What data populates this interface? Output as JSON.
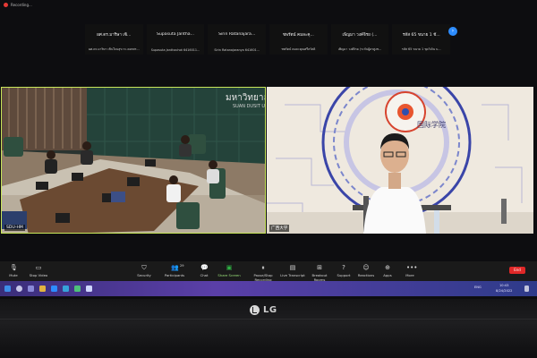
{
  "window": {
    "recording_label": "Recording..."
  },
  "participants_strip": [
    {
      "name": "ผศ.ดร.มาริษา เซ็...",
      "sub": "ผศ.ดร.มาริษา เซ็นใจนสุข ระ.คยรศร..."
    },
    {
      "name": "Supasuta Jantha...",
      "sub": "Supasuta Janthachot 6416011..."
    },
    {
      "name": "Sirin Ratanajara...",
      "sub": "Sirin Ratanajaranya 641601..."
    },
    {
      "name": "ชพรัตน์ คมละคุ...",
      "sub": "ชพรัตน์ คมละคุณศรีสวัสดิ์"
    },
    {
      "name": "เพ็ญมา วงค์จิรย (...",
      "sub": "เพ็ญมา วงศ์จิรย (ระกับผู้ดรสูงช..."
    },
    {
      "name": "รหัส 65 ขนาย 1 ชั...",
      "sub": "รหัส 65 ขนาย 1 ชุดวิเจิน บ..."
    }
  ],
  "video_tiles": [
    {
      "label": "SDU-HM",
      "wall_text": "มหาวิทยาลั",
      "wall_subtext": "SUAN DUSIT U"
    },
    {
      "label": "广西大学",
      "banner_text": "国际学院"
    }
  ],
  "toolbar": {
    "mute": "Mute",
    "stop_video": "Stop Video",
    "security": "Security",
    "participants": "Participants",
    "participants_count": "29",
    "chat": "Chat",
    "share_screen": "Share Screen",
    "pause_recording": "Pause/Stop Recording",
    "live_transcript": "Live Transcript",
    "breakout_rooms": "Breakout Rooms",
    "support": "Support",
    "reactions": "Reactions",
    "apps": "Apps",
    "more": "More",
    "end": "End"
  },
  "taskbar": {
    "language": "ENG",
    "time": "10:43",
    "date": "8/24/2022"
  },
  "monitor": {
    "brand": "LG"
  },
  "colors": {
    "active_speaker_border": "#c8e65a",
    "end_button": "#e02828",
    "accent": "#2d8cff"
  }
}
